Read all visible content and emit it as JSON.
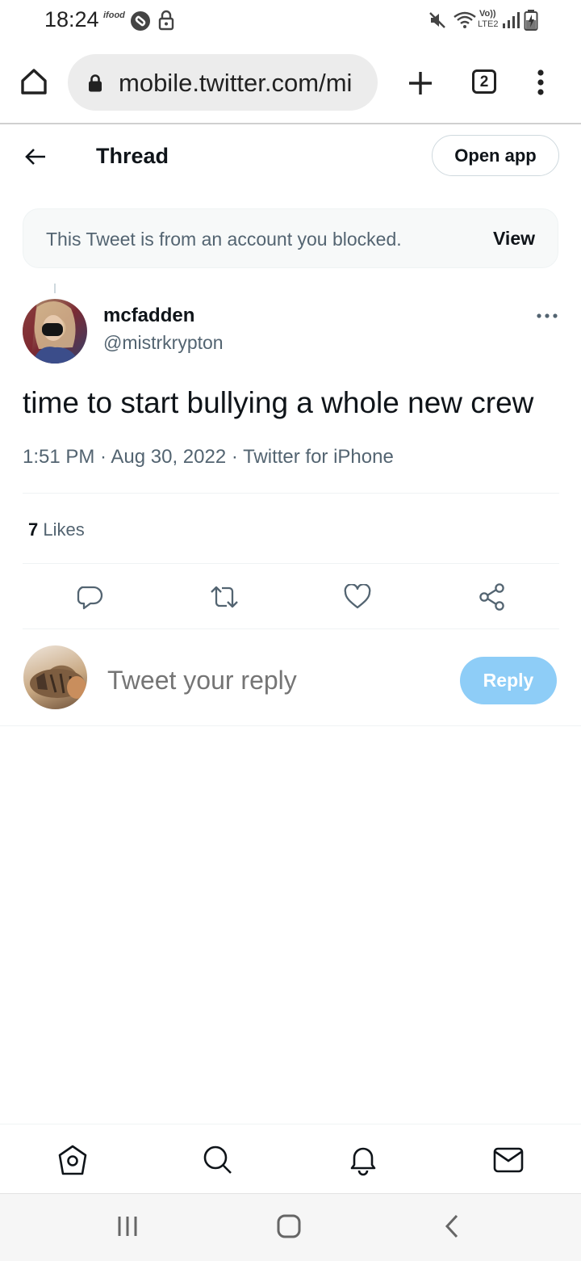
{
  "status_bar": {
    "time": "18:24",
    "notif_label": "ifood",
    "network_label_top": "Vo))",
    "network_label_bottom": "LTE2",
    "icons": [
      "ifood-icon",
      "shazam-icon",
      "lock-icon",
      "mute-icon",
      "wifi-icon",
      "signal-icon",
      "battery-icon"
    ]
  },
  "browser": {
    "url": "mobile.twitter.com/mi",
    "tab_count": "2",
    "icons": [
      "home-icon",
      "lock-icon",
      "new-tab-icon",
      "tabs-icon",
      "menu-icon"
    ]
  },
  "thread": {
    "title": "Thread",
    "open_app_label": "Open app"
  },
  "banner": {
    "text": "This Tweet is from an account you blocked.",
    "view_label": "View"
  },
  "tweet": {
    "name": "mcfadden",
    "handle": "@mistrkrypton",
    "text": "time to start bullying a whole new crew",
    "meta": "1:51 PM · Aug 30, 2022 · Twitter for iPhone",
    "likes_count": "7",
    "likes_label": "Likes",
    "actions": [
      "reply-icon",
      "retweet-icon",
      "like-icon",
      "share-icon"
    ]
  },
  "reply": {
    "placeholder": "Tweet your reply",
    "button_label": "Reply"
  },
  "colors": {
    "accent": "#1d9bf0",
    "reply_button_disabled": "#8ecdf7",
    "secondary_text": "#536471"
  }
}
